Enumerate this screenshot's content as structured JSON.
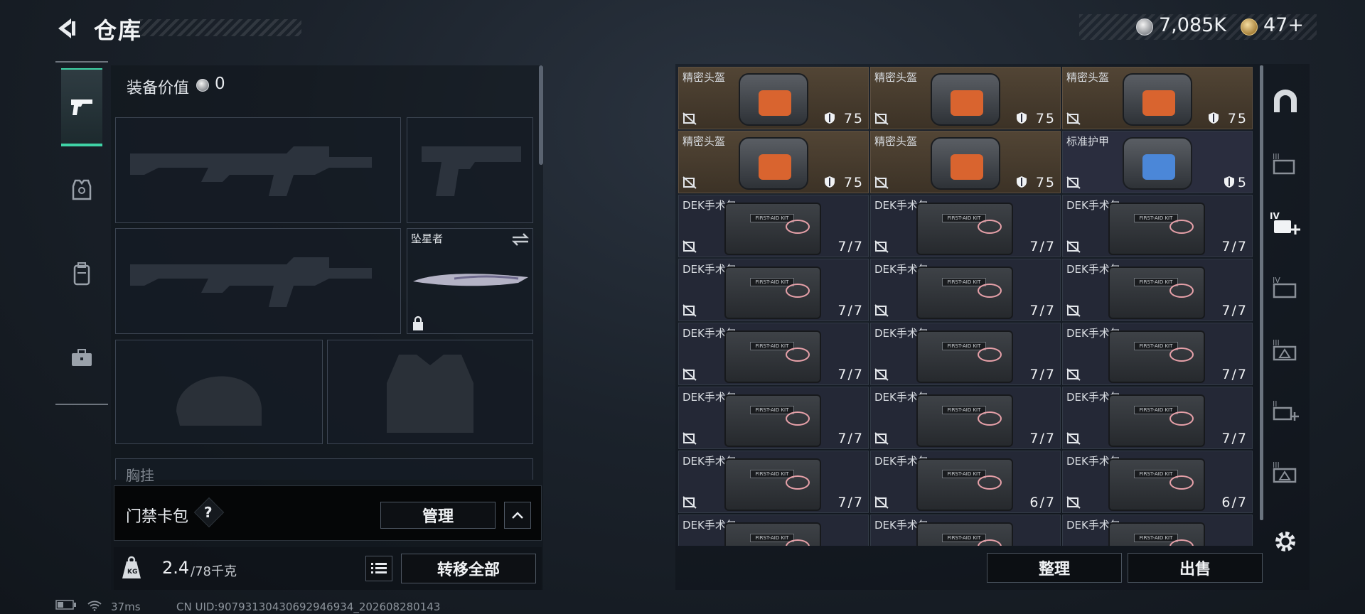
{
  "header": {
    "title": "仓库",
    "currency_silver": "7,085K",
    "currency_gold": "47+"
  },
  "loadout": {
    "value_label": "装备价值",
    "value": "0",
    "melee_name": "坠星者",
    "chest_rig_label": "胸挂"
  },
  "keycard": {
    "label": "门禁卡包",
    "help": "?",
    "manage_label": "管理"
  },
  "weight": {
    "current": "2.4",
    "max": "/78千克",
    "transfer_all_label": "转移全部"
  },
  "inventory": {
    "items": [
      {
        "name": "精密头盔",
        "qty": "75",
        "type": "helmet",
        "color": "brown"
      },
      {
        "name": "精密头盔",
        "qty": "75",
        "type": "helmet",
        "color": "brown"
      },
      {
        "name": "精密头盔",
        "qty": "75",
        "type": "helmet",
        "color": "brown"
      },
      {
        "name": "精密头盔",
        "qty": "75",
        "type": "helmet",
        "color": "brown"
      },
      {
        "name": "精密头盔",
        "qty": "75",
        "type": "helmet",
        "color": "brown"
      },
      {
        "name": "标准护甲",
        "qty": "5",
        "type": "armor",
        "color": "navy"
      },
      {
        "name": "DEK手术包",
        "qty": "7/7",
        "type": "medkit"
      },
      {
        "name": "DEK手术包",
        "qty": "7/7",
        "type": "medkit"
      },
      {
        "name": "DEK手术包",
        "qty": "7/7",
        "type": "medkit"
      },
      {
        "name": "DEK手术包",
        "qty": "7/7",
        "type": "medkit"
      },
      {
        "name": "DEK手术包",
        "qty": "7/7",
        "type": "medkit"
      },
      {
        "name": "DEK手术包",
        "qty": "7/7",
        "type": "medkit"
      },
      {
        "name": "DEK手术包",
        "qty": "7/7",
        "type": "medkit"
      },
      {
        "name": "DEK手术包",
        "qty": "7/7",
        "type": "medkit"
      },
      {
        "name": "DEK手术包",
        "qty": "7/7",
        "type": "medkit"
      },
      {
        "name": "DEK手术包",
        "qty": "7/7",
        "type": "medkit"
      },
      {
        "name": "DEK手术包",
        "qty": "7/7",
        "type": "medkit"
      },
      {
        "name": "DEK手术包",
        "qty": "7/7",
        "type": "medkit"
      },
      {
        "name": "DEK手术包",
        "qty": "7/7",
        "type": "medkit"
      },
      {
        "name": "DEK手术包",
        "qty": "6/7",
        "type": "medkit"
      },
      {
        "name": "DEK手术包",
        "qty": "6/7",
        "type": "medkit"
      },
      {
        "name": "DEK手术包",
        "qty": "",
        "type": "medkit"
      },
      {
        "name": "DEK手术包",
        "qty": "",
        "type": "medkit"
      },
      {
        "name": "DEK手术包",
        "qty": "",
        "type": "medkit"
      }
    ],
    "sort_label": "整理",
    "sell_label": "出售",
    "rail_icons": [
      "IV",
      "III",
      "III",
      "II",
      "III"
    ]
  },
  "status": {
    "ping": "37ms",
    "uid": "CN UID:907931304306929469​34_202608280143"
  },
  "colors": {
    "accent": "#3fd3a6",
    "helmet_bg": "#4a3e30",
    "armor_bg": "#2a2d3e",
    "medkit_bg": "#242836"
  }
}
